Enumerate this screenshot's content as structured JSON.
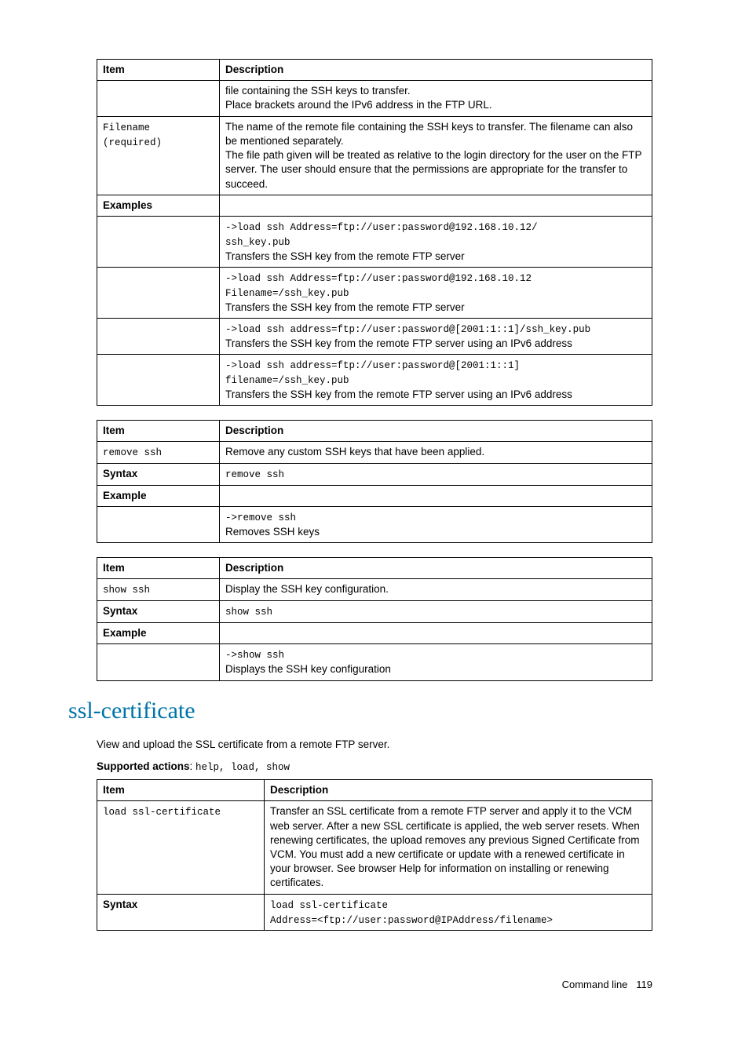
{
  "table1": {
    "h_item": "Item",
    "h_desc": "Description",
    "r1_desc_l1": "file containing the SSH keys to transfer.",
    "r1_desc_l2": "Place brackets around the IPv6 address in the FTP URL.",
    "r2_item_l1": "Filename",
    "r2_item_l2": "(required)",
    "r2_desc_l1": "The name of the remote file containing the SSH keys to transfer. The filename can also be mentioned separately.",
    "r2_desc_l2": "The file path given will be treated as relative to the login directory for the user on the FTP server. The user should ensure that the permissions are appropriate for the transfer to succeed.",
    "r3_item": "Examples",
    "r4_m1": "->load ssh Address=ftp://user:password@192.168.10.12/",
    "r4_m2": "ssh_key.pub",
    "r4_t": "Transfers the SSH key from the remote FTP server",
    "r5_m1": "->load ssh Address=ftp://user:password@192.168.10.12",
    "r5_m2": "Filename=/ssh_key.pub",
    "r5_t": "Transfers the SSH key from the remote FTP server",
    "r6_m1": "->load ssh address=ftp://user:password@[2001:1::1]/ssh_key.pub",
    "r6_t": "Transfers the SSH key from the remote FTP server using an IPv6 address",
    "r7_m1": "->load ssh address=ftp://user:password@[2001:1::1]",
    "r7_m2": "filename=/ssh_key.pub",
    "r7_t": "Transfers the SSH key from the remote FTP server using an IPv6 address"
  },
  "table2": {
    "h_item": "Item",
    "h_desc": "Description",
    "r1_item": "remove ssh",
    "r1_desc": "Remove any custom SSH keys that have been applied.",
    "r2_item": "Syntax",
    "r2_desc": "remove ssh",
    "r3_item": "Example",
    "r4_m": "->remove ssh",
    "r4_t": "Removes SSH keys"
  },
  "table3": {
    "h_item": "Item",
    "h_desc": "Description",
    "r1_item": "show ssh",
    "r1_desc": "Display the SSH key configuration.",
    "r2_item": "Syntax",
    "r2_desc": "show ssh",
    "r3_item": "Example",
    "r4_m": "->show ssh",
    "r4_t": "Displays the SSH key configuration"
  },
  "section": {
    "title": "ssl-certificate",
    "intro": "View and upload the SSL certificate from a remote FTP server.",
    "supported_label": "Supported actions",
    "supported_sep": ": ",
    "supported_vals": "help, load, show"
  },
  "table4": {
    "h_item": "Item",
    "h_desc": "Description",
    "r1_item": "load ssl-certificate",
    "r1_desc": "Transfer an SSL certificate from a remote FTP server and apply it to the VCM web server. After a new SSL certificate is applied, the web server resets. When renewing certificates, the upload removes any previous Signed Certificate from VCM. You must add a new certificate or update with a renewed certificate in your browser. See browser Help for information on installing or renewing certificates.",
    "r2_item": "Syntax",
    "r2_m1": "load ssl-certificate",
    "r2_m2": "Address=<ftp://user:password@IPAddress/filename>"
  },
  "footer": {
    "label": "Command line",
    "page": "119"
  }
}
